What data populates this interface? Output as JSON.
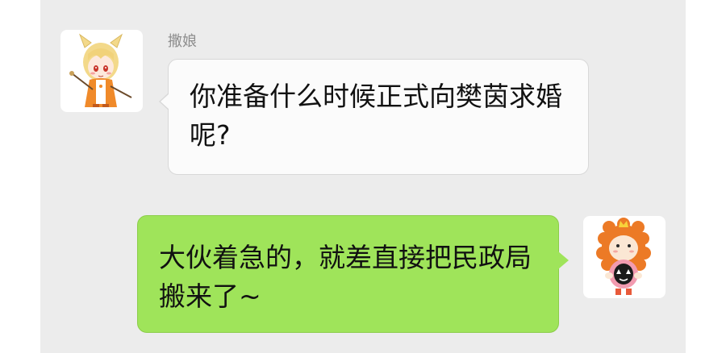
{
  "chat": {
    "panel_color": "#ececec",
    "incoming": {
      "sender_name": "撒娘",
      "avatar": "cat-girl-avatar-icon",
      "text": "你准备什么时候正式向樊茵求婚呢?"
    },
    "outgoing": {
      "avatar": "lion-avatar-icon",
      "text": "大伙着急的，就差直接把民政局搬来了~",
      "bubble_color": "#9fe45a"
    }
  }
}
